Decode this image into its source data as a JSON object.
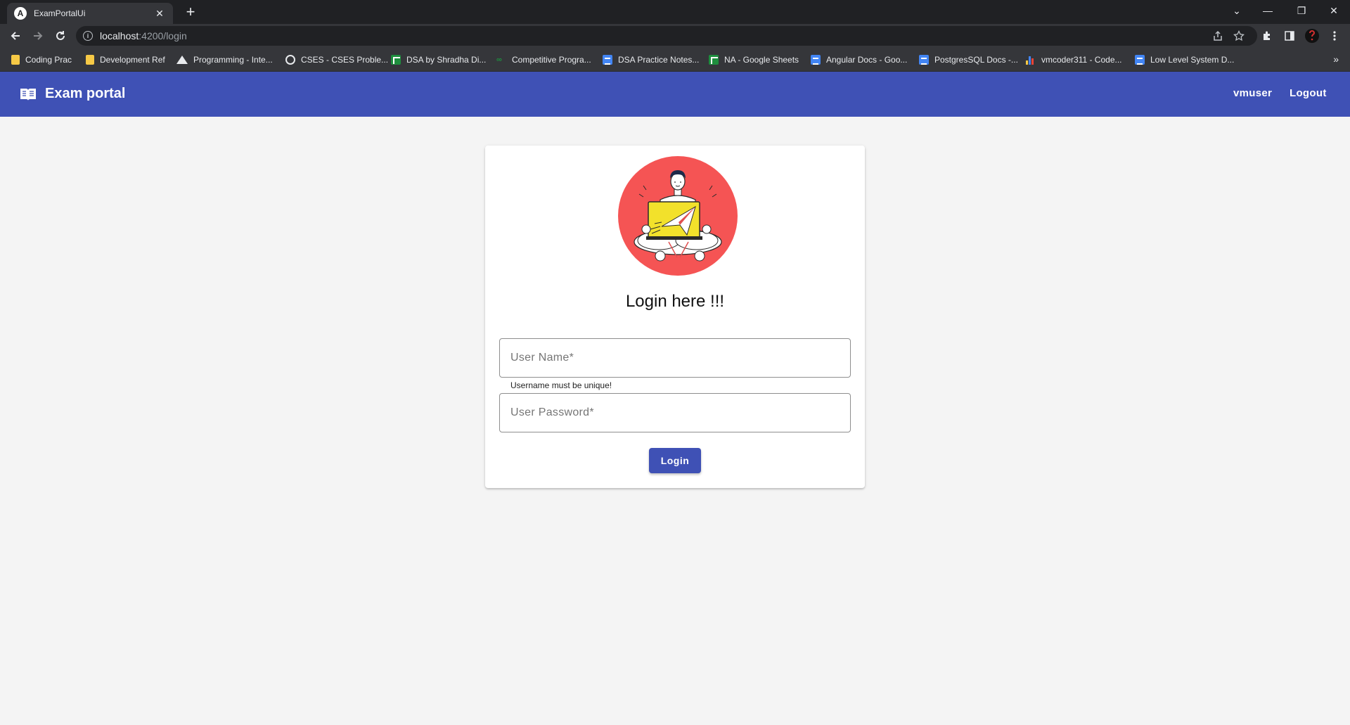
{
  "browser": {
    "tab_title": "ExamPortalUi",
    "tab_favicon": "A",
    "url_host": "localhost",
    "url_path": ":4200/login",
    "bookmarks": [
      {
        "label": "Coding Prac",
        "icon": "folder-icon"
      },
      {
        "label": "Development Ref",
        "icon": "folder-icon"
      },
      {
        "label": "Programming - Inte...",
        "icon": "triangle-icon"
      },
      {
        "label": "CSES - CSES Proble...",
        "icon": "globe-icon"
      },
      {
        "label": "DSA by Shradha Di...",
        "icon": "sheets-icon"
      },
      {
        "label": "Competitive Progra...",
        "icon": "codeforces-icon"
      },
      {
        "label": "DSA Practice Notes...",
        "icon": "docs-icon"
      },
      {
        "label": "NA - Google Sheets",
        "icon": "sheets-icon"
      },
      {
        "label": "Angular Docs - Goo...",
        "icon": "docs-icon"
      },
      {
        "label": "PostgresSQL Docs -...",
        "icon": "docs-icon"
      },
      {
        "label": "vmcoder311 - Code...",
        "icon": "bars-icon"
      },
      {
        "label": "Low Level System D...",
        "icon": "docs-icon"
      }
    ]
  },
  "navbar": {
    "title": "Exam portal",
    "user_link": "vmuser",
    "logout_link": "Logout",
    "color": "#3f51b5"
  },
  "login": {
    "heading": "Login here !!!",
    "username_placeholder": "User Name*",
    "username_hint": "Username must be unique!",
    "password_placeholder": "User Password*",
    "button_label": "Login"
  }
}
